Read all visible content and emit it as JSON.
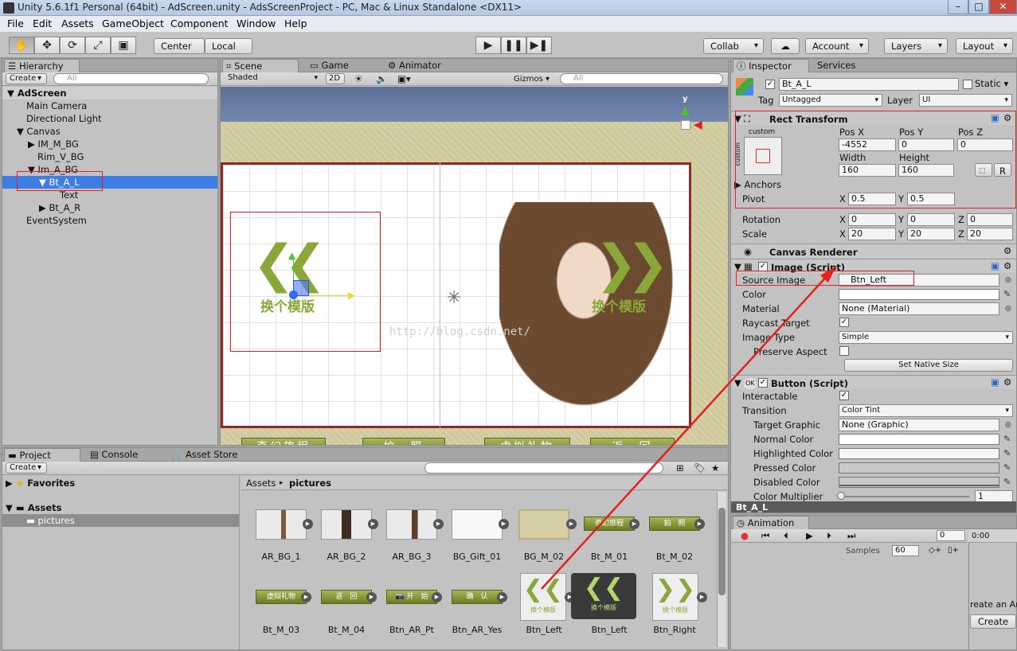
{
  "window": {
    "title": "Unity 5.6.1f1 Personal (64bit) - AdScreen.unity - AdsScreenProject - PC, Mac & Linux Standalone <DX11>"
  },
  "menu": [
    "File",
    "Edit",
    "Assets",
    "GameObject",
    "Component",
    "Window",
    "Help"
  ],
  "toolbar": {
    "pivot": "Center",
    "space": "Local",
    "collab": "Collab",
    "account": "Account",
    "layers": "Layers",
    "layout": "Layout"
  },
  "hierarchy": {
    "tab": "Hierarchy",
    "create": "Create",
    "search": "All",
    "scene": "AdScreen",
    "items": [
      "Main Camera",
      "Directional Light",
      "Canvas",
      "IM_M_BG",
      "Rim_V_BG",
      "Im_A_BG",
      "Bt_A_L",
      "Text",
      "Bt_A_R",
      "EventSystem"
    ]
  },
  "scene": {
    "tabs": [
      "Scene",
      "Game",
      "Animator"
    ],
    "shading": "Shaded",
    "mode2d": "2D",
    "gizmos": "Gizmos",
    "search": "All",
    "button_text": "换个模版",
    "watermark": "http://blog.csdn.net/",
    "bottom_buttons": [
      "奇幻旅程",
      "拍　照",
      "虚拟礼物",
      "返　回"
    ],
    "gizmo_axis": "y"
  },
  "project": {
    "tabs": [
      "Project",
      "Console",
      "Asset Store"
    ],
    "create": "Create",
    "favorites": "Favorites",
    "assets": "Assets",
    "folder": "pictures",
    "breadcrumb": [
      "Assets",
      "pictures"
    ],
    "row1": [
      "AR_BG_1",
      "AR_BG_2",
      "AR_BG_3",
      "BG_Gift_01",
      "BG_M_02",
      "Bt_M_01",
      "Bt_M_02"
    ],
    "row2": [
      "Bt_M_03",
      "Bt_M_04",
      "Btn_AR_Pt",
      "Btn_AR_Yes",
      "Btn_Left",
      "Btn_Left",
      "Btn_Right"
    ],
    "thumb_texts": [
      "奇幻旅程",
      "拍　照",
      "虚拟礼物",
      "返　回",
      "开　始",
      "确　认",
      "换个模版"
    ]
  },
  "inspector": {
    "tabs": [
      "Inspector",
      "Services"
    ],
    "object_name": "Bt_A_L",
    "static": "Static",
    "tag_label": "Tag",
    "tag": "Untagged",
    "layer_label": "Layer",
    "layer": "UI",
    "rect": {
      "title": "Rect Transform",
      "anchor_preset": "custom",
      "anchor_side": "custom",
      "posx_l": "Pos X",
      "posy_l": "Pos Y",
      "posz_l": "Pos Z",
      "posx": "-4552",
      "posy": "0",
      "posz": "0",
      "width_l": "Width",
      "height_l": "Height",
      "width": "160",
      "height": "160",
      "r_btn": "R",
      "anchors": "Anchors",
      "pivot": "Pivot",
      "pivot_x": "0.5",
      "pivot_y": "0.5",
      "rotation": "Rotation",
      "rot": [
        "0",
        "0",
        "0"
      ],
      "scale": "Scale",
      "scl": [
        "20",
        "20",
        "20"
      ],
      "x": "X",
      "y": "Y",
      "z": "Z"
    },
    "canvas_renderer": "Canvas Renderer",
    "image": {
      "title": "Image (Script)",
      "source_l": "Source Image",
      "source": "Btn_Left",
      "color_l": "Color",
      "material_l": "Material",
      "material": "None (Material)",
      "raycast_l": "Raycast Target",
      "type_l": "Image Type",
      "type": "Simple",
      "preserve_l": "Preserve Aspect",
      "native_btn": "Set Native Size"
    },
    "button": {
      "title": "Button (Script)",
      "interactable_l": "Interactable",
      "transition_l": "Transition",
      "transition": "Color Tint",
      "target_l": "Target Graphic",
      "target": "None (Graphic)",
      "normal": "Normal Color",
      "highlighted": "Highlighted Color",
      "pressed": "Pressed Color",
      "disabled": "Disabled Color",
      "multiplier": "Color Multiplier",
      "multiplier_val": "1"
    },
    "footer": "Bt_A_L"
  },
  "animation": {
    "tab": "Animation",
    "samples_l": "Samples",
    "samples": "60",
    "frame": "0",
    "timeline": "0:00",
    "create_text": "reate an Ar",
    "create_btn": "Create"
  },
  "colors": {
    "selection": "#3e7de6",
    "arrow": "#e3201b",
    "green": "#8aa83a"
  }
}
